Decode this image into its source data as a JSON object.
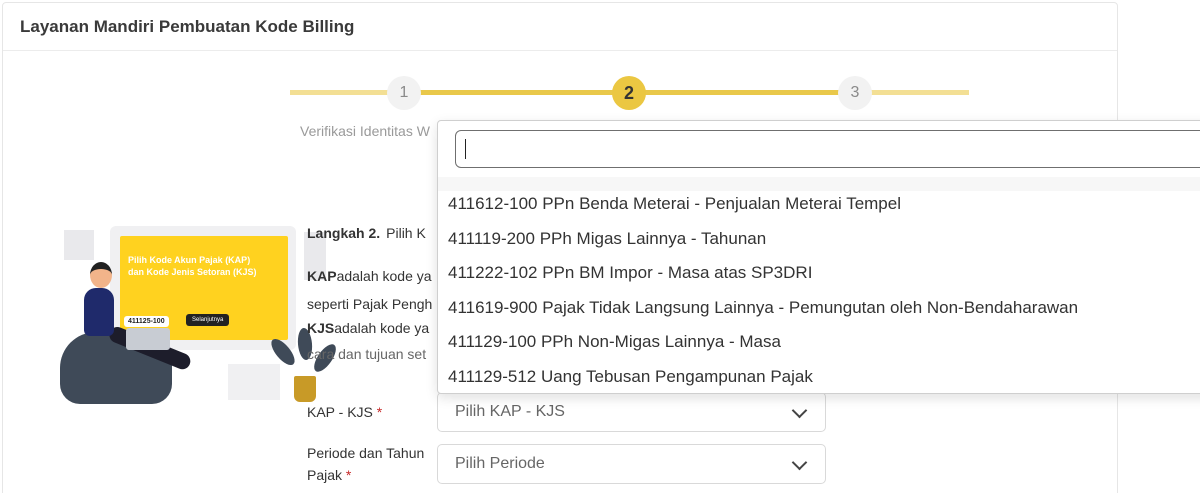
{
  "header": {
    "title": "Layanan Mandiri Pembuatan Kode Billing"
  },
  "stepper": {
    "steps": [
      {
        "number": "1",
        "state": "done"
      },
      {
        "number": "2",
        "state": "active"
      },
      {
        "number": "3",
        "state": "pending"
      }
    ],
    "current_label": "Verifikasi Identitas W"
  },
  "illustration": {
    "screen_text_1": "Pilih Kode Akun Pajak (KAP)",
    "screen_text_2": "dan Kode Jenis Setoran (KJS)",
    "screen_code": "411125-100",
    "screen_button": "Selanjutnya"
  },
  "content": {
    "step_title": "Langkah 2.",
    "step_desc": "Pilih K",
    "kap_term": "KAP",
    "kap_line1": "adalah kode ya",
    "kap_line2": "seperti Pajak Pengh",
    "kjs_term": "KJS",
    "kjs_line1": "adalah kode ya",
    "kjs_line2": "cara dan tujuan set"
  },
  "form": {
    "kap_label": "KAP - KJS",
    "kap_required": "*",
    "kap_placeholder": "Pilih KAP - KJS",
    "periode_label_1": "Periode dan Tahun",
    "periode_label_2": "Pajak",
    "periode_required": "*",
    "periode_placeholder": "Pilih Periode"
  },
  "dropdown": {
    "search_value": "",
    "options": [
      "411612-100 PPn Benda Meterai - Penjualan Meterai Tempel",
      "411119-200 PPh Migas Lainnya - Tahunan",
      "411222-102 PPn BM Impor - Masa atas SP3DRI",
      "411619-900 Pajak Tidak Langsung Lainnya - Pemungutan oleh Non-Bendaharawan",
      "411129-100 PPh Non-Migas Lainnya - Masa",
      "411129-512 Uang Tebusan Pengampunan Pajak"
    ]
  },
  "colors": {
    "accent": "#ebc742",
    "accent_light": "#f3df94",
    "required": "#c62828",
    "illustration_yellow": "#ffd21f"
  }
}
